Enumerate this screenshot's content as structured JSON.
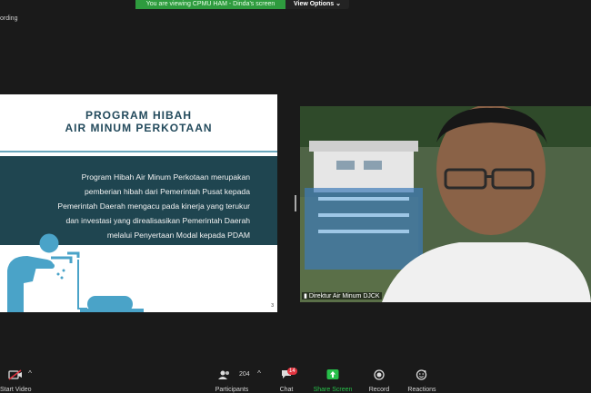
{
  "banner": {
    "viewing_text": "You are viewing CPMU HAM - Dinda's screen",
    "view_options": "View Options"
  },
  "recording_label": "ording",
  "slide": {
    "title_line1": "PROGRAM HIBAH",
    "title_line2": "AIR MINUM PERKOTAAN",
    "body_lines": [
      "Program Hibah Air Minum Perkotaan merupakan",
      "pemberian hibah dari Pemerintah Pusat kepada",
      "Pemerintah Daerah mengacu pada kinerja yang terukur",
      "dan investasi yang direalisasikan Pemerintah Daerah",
      "melalui Penyertaan Modal kepada PDAM"
    ],
    "page_number": "3"
  },
  "video": {
    "participant_label": "Direktur Air Minum DJCK"
  },
  "toolbar": {
    "start_video": "Start Video",
    "participants": "Participants",
    "participants_count": "204",
    "chat": "Chat",
    "chat_badge": "14",
    "share_screen": "Share Screen",
    "record": "Record",
    "reactions": "Reactions"
  },
  "colors": {
    "banner_green": "#2e9b3e",
    "slide_title": "#234a5c",
    "slide_box": "#1f4550",
    "icon_blue": "#4aa3c8",
    "share_green": "#27c04a",
    "badge_red": "#e0343f"
  }
}
